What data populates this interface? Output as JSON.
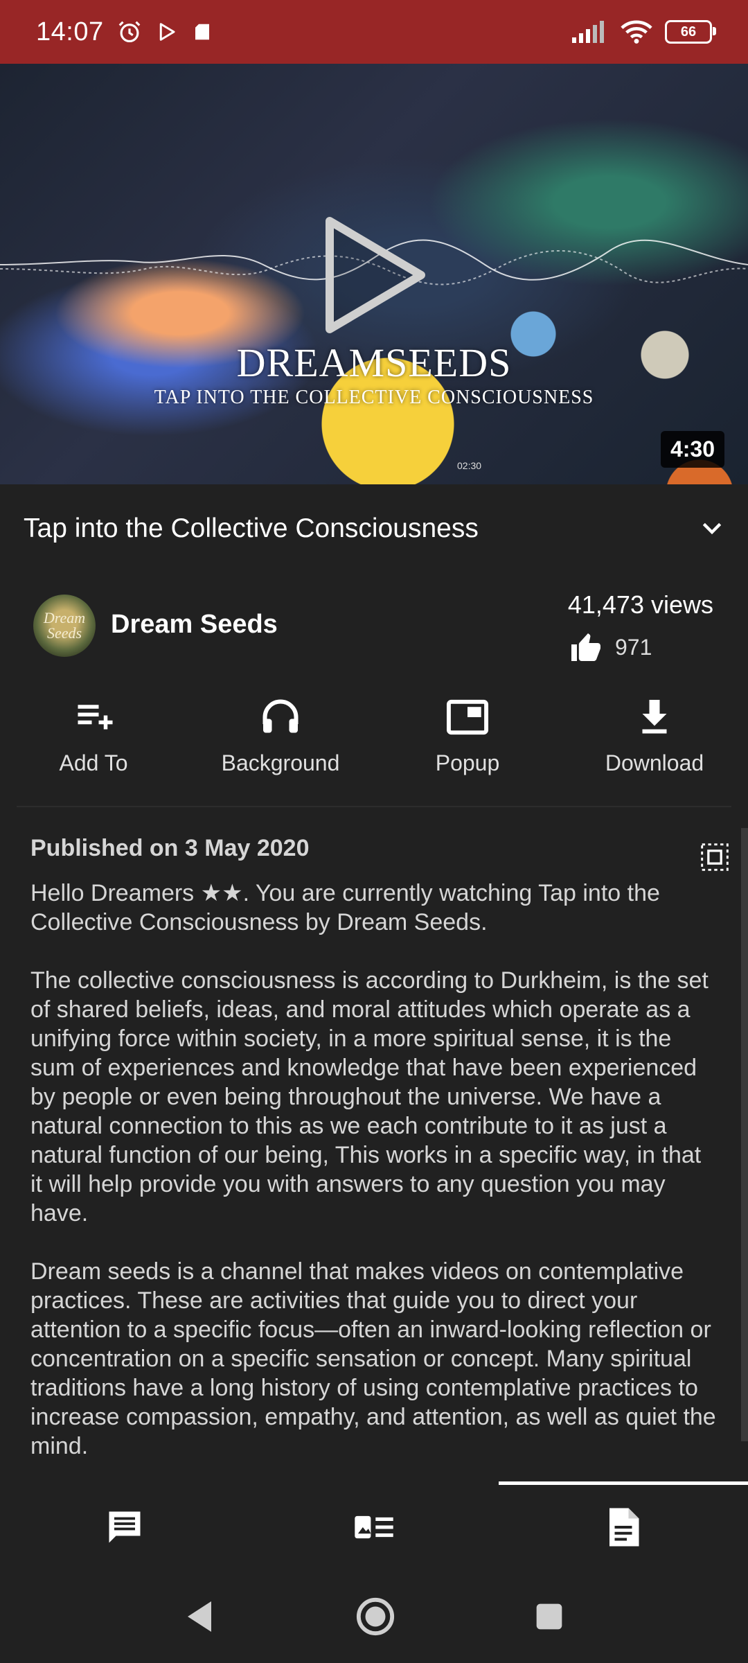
{
  "status_bar": {
    "time": "14:07",
    "battery": "66",
    "icons": [
      "alarm-icon",
      "play-store-icon",
      "card-icon",
      "signal-icon",
      "wifi-icon",
      "battery-icon"
    ]
  },
  "video": {
    "overlay_title": "DREAMSEEDS",
    "overlay_subtitle": "TAP INTO THE COLLECTIVE CONSCIOUSNESS",
    "timestamp_small": "02:30",
    "duration": "4:30"
  },
  "title": "Tap into the Collective Consciousness",
  "channel": {
    "avatar_text": "Dream Seeds",
    "name": "Dream Seeds",
    "views": "41,473 views",
    "likes": "971"
  },
  "actions": [
    {
      "label": "Add To",
      "icon": "playlist-add-icon"
    },
    {
      "label": "Background",
      "icon": "headphones-icon"
    },
    {
      "label": "Popup",
      "icon": "popup-icon"
    },
    {
      "label": "Download",
      "icon": "download-icon"
    }
  ],
  "description": {
    "published": "Published on 3 May 2020",
    "paragraphs": [
      "Hello Dreamers ★★.  You are currently watching Tap into the Collective Consciousness by Dream Seeds.",
      "The collective consciousness is according to Durkheim, is the set of shared beliefs, ideas, and moral attitudes which operate as a unifying force within society, in a more spiritual sense, it is the sum of experiences and knowledge that have been experienced by people or even being throughout the universe. We have a natural connection to this as we each contribute to it as just a natural function of our being, This works in a specific way, in that it will help provide you with answers to any question you may have.",
      "Dream seeds is a channel that makes videos on contemplative practices. These are activities that guide you to direct your attention to a specific focus—often an inward-looking reflection or concentration on a specific sensation or concept. Many spiritual traditions have a long history of using contemplative practices to increase compassion, empathy, and attention, as well as quiet the mind."
    ]
  },
  "bottom_tabs": [
    "comments-icon",
    "related-items-icon",
    "description-icon"
  ],
  "nav": [
    "back-icon",
    "home-icon",
    "recents-icon"
  ],
  "colors": {
    "status_bar": "#982626",
    "background": "#212121"
  }
}
